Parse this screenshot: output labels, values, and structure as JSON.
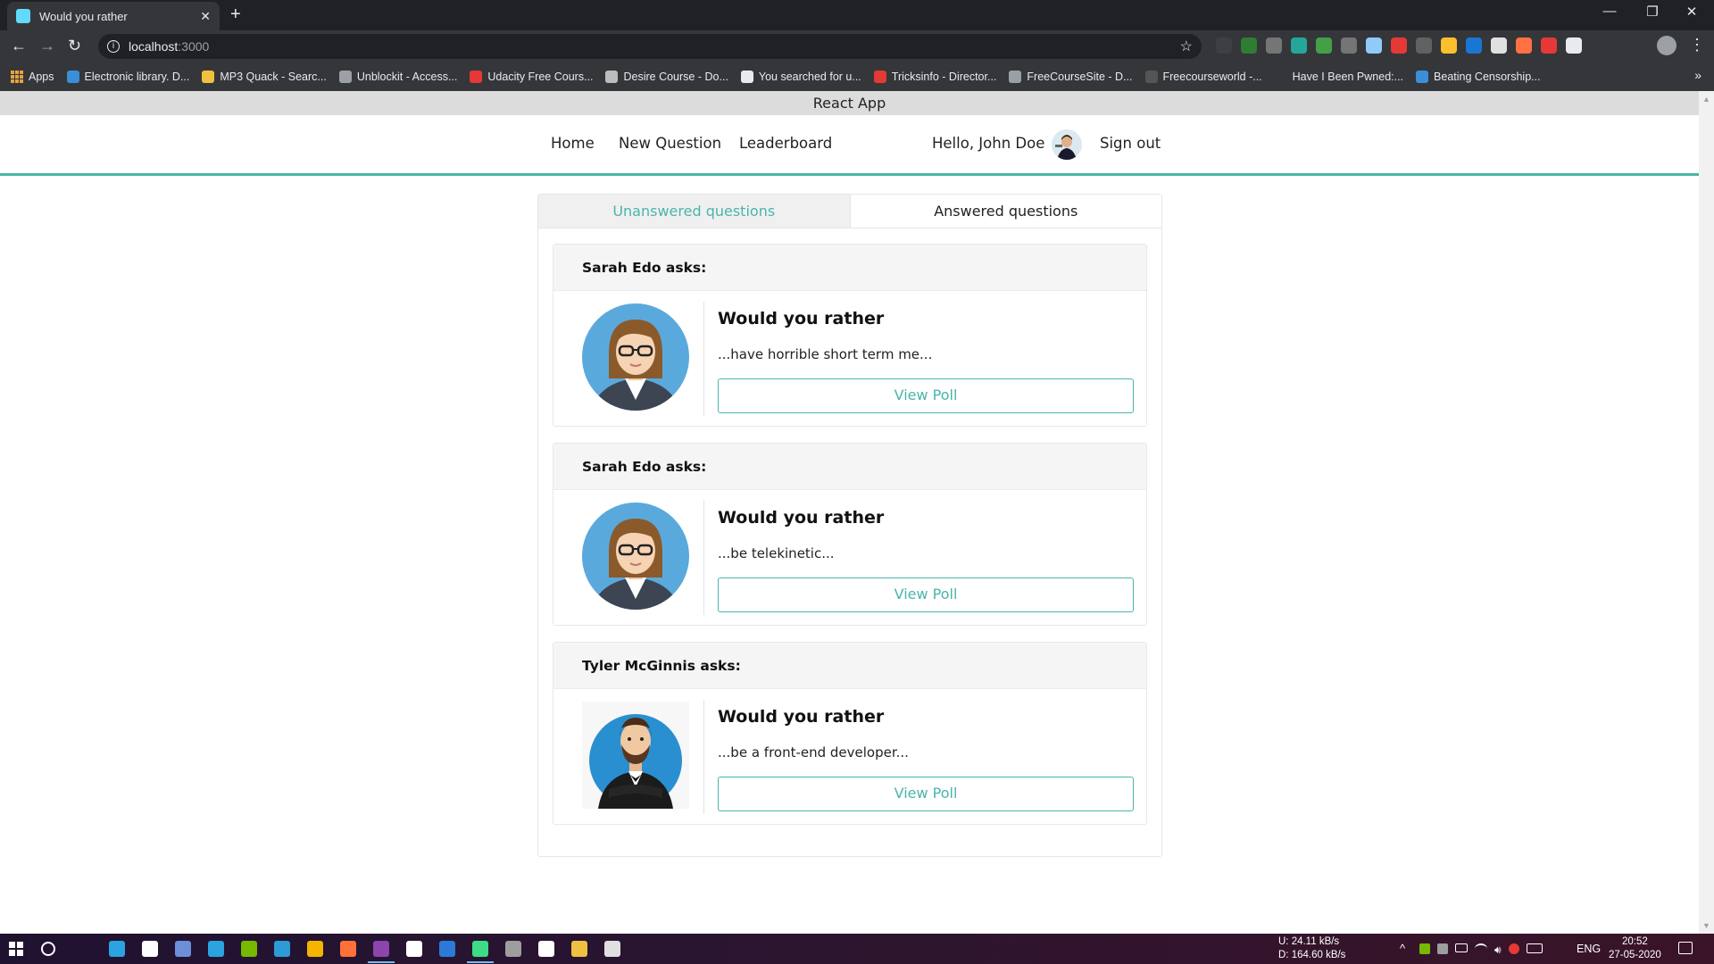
{
  "browser": {
    "tab": {
      "title": "Would you rather",
      "close": "✕"
    },
    "new_tab": "+",
    "window_controls": {
      "minimize": "—",
      "restore": "❐",
      "close": "✕"
    },
    "nav": {
      "back": "←",
      "forward": "→",
      "reload": "↻"
    },
    "address": {
      "host": "localhost",
      "port": ":3000",
      "info": "i",
      "star": "☆"
    },
    "menu": "⋮",
    "bookmarks": [
      {
        "label": "Apps",
        "color": "#e8a33d"
      },
      {
        "label": "Electronic library. D...",
        "color": "#3b8fd9"
      },
      {
        "label": "MP3 Quack - Searc...",
        "color": "#f0c040"
      },
      {
        "label": "Unblockit - Access...",
        "color": "#9aa0a6"
      },
      {
        "label": "Udacity Free Cours...",
        "color": "#e53935"
      },
      {
        "label": "Desire Course - Do...",
        "color": "#bdbdbd"
      },
      {
        "label": "You searched for u...",
        "color": "#e8eaed"
      },
      {
        "label": "Tricksinfo - Director...",
        "color": "#e53935"
      },
      {
        "label": "FreeCourseSite - D...",
        "color": "#9aa0a6"
      },
      {
        "label": "Freecourseworld -...",
        "color": "#555555"
      },
      {
        "label": "Have I Been Pwned:...",
        "color": "#35363a"
      },
      {
        "label": "Beating Censorship...",
        "color": "#3b8fd9"
      }
    ],
    "bookmarks_more": "»",
    "extensions": [
      "#3c4043",
      "#2e7d32",
      "#757575",
      "#26a69a",
      "#43a047",
      "#757575",
      "#90caf9",
      "#e53935",
      "#616161",
      "#fbc02d",
      "#1976d2",
      "#e0e0e0",
      "#ff7043",
      "#e53935",
      "#e8eaed"
    ]
  },
  "app": {
    "title": "React App",
    "nav": {
      "home": "Home",
      "new_question": "New Question",
      "leaderboard": "Leaderboard",
      "greeting": "Hello, John Doe",
      "sign_out": "Sign out"
    },
    "tabs": {
      "unanswered": "Unanswered questions",
      "answered": "Answered questions"
    },
    "questions": [
      {
        "author": "Sarah Edo asks:",
        "title": "Would you rather",
        "text": "...have horrible short term me...",
        "button": "View Poll",
        "avatar": "sarah"
      },
      {
        "author": "Sarah Edo asks:",
        "title": "Would you rather",
        "text": "...be telekinetic...",
        "button": "View Poll",
        "avatar": "sarah"
      },
      {
        "author": "Tyler McGinnis asks:",
        "title": "Would you rather",
        "text": "...be a front-end developer...",
        "button": "View Poll",
        "avatar": "tyler"
      }
    ],
    "accent_color": "#4ab5aa"
  },
  "taskbar": {
    "network": {
      "up": "U:    24.11 kB/s",
      "down": "D:  164.60 kB/s"
    },
    "language": "ENG",
    "time": "20:52",
    "date": "27-05-2020",
    "tray_chevron": "^",
    "apps": [
      "#2aa3e0",
      "#ffffff",
      "#6c8fd9",
      "#2aa3e0",
      "#76b900",
      "#2c9bd6",
      "#f4b400",
      "#ff7139",
      "#8e44ad",
      "#ffffff",
      "#2b7bd6",
      "#3ddc84",
      "#9e9e9e",
      "#ffffff",
      "#f0c040",
      "#e0e0e0"
    ]
  }
}
